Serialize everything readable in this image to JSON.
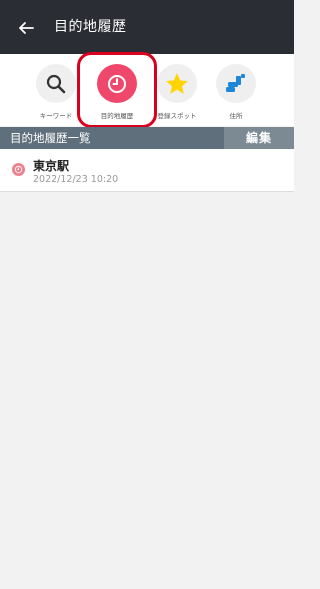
{
  "header": {
    "title": "目的地履歴"
  },
  "categories": [
    {
      "label": "キーワード",
      "icon": "search-icon"
    },
    {
      "label": "目的地履歴",
      "icon": "clock-icon",
      "color": "#f0486c"
    },
    {
      "label": "登録スポット",
      "icon": "star-icon",
      "color": "#ffd400"
    },
    {
      "label": "住所",
      "icon": "address-icon",
      "color": "#1e88d8"
    }
  ],
  "section": {
    "title": "目的地履歴一覧",
    "edit_label": "編集"
  },
  "history": [
    {
      "name": "東京駅",
      "datetime": "2022/12/23 10:20"
    }
  ],
  "colors": {
    "topbar": "#2b2d34",
    "highlight": "#d9001f",
    "section": "#5f6f7b"
  }
}
